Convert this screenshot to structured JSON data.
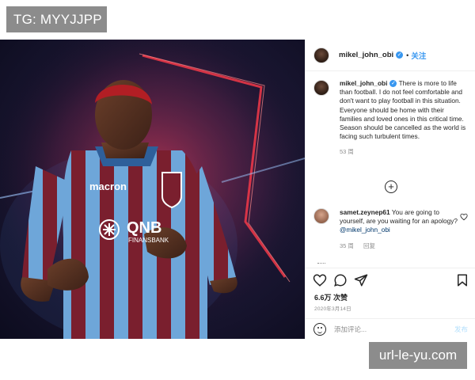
{
  "overlay": {
    "tg_label": "TG: MYYJJPP",
    "watermark": "url-le-yu.com"
  },
  "photo": {
    "kit_brand": "macron",
    "sponsor_main": "QNB",
    "sponsor_sub": "FINANSBANK",
    "icon": "player-photo"
  },
  "post": {
    "header": {
      "username": "mikel_john_obi",
      "verified_icon": "verified-badge-icon",
      "separator": "•",
      "follow_label": "关注"
    },
    "caption": {
      "username": "mikel_john_obi",
      "text": "There is more to life than football. I do not feel comfortable and don't want to play football in this situation. Everyone should be home with their families and loved ones in this critical time. Season should be cancelled as the world is facing such turbulent times.",
      "time": "53 周"
    },
    "load_more_label": "+",
    "comment": {
      "username": "samet.zeynep61",
      "text": "You are going to yourself, are you waiting for an apology?",
      "mention": "@mikel_john_obi",
      "time": "35 周",
      "reply_label": "回复"
    },
    "likes": "6.6万 次赞",
    "date": "2020年3月14日",
    "add_comment_placeholder": "添加评论...",
    "post_label": "发布"
  },
  "colors": {
    "accent": "#3897f0",
    "text": "#262626",
    "muted": "#8e8e8e",
    "post_disabled": "#b2dffc"
  }
}
